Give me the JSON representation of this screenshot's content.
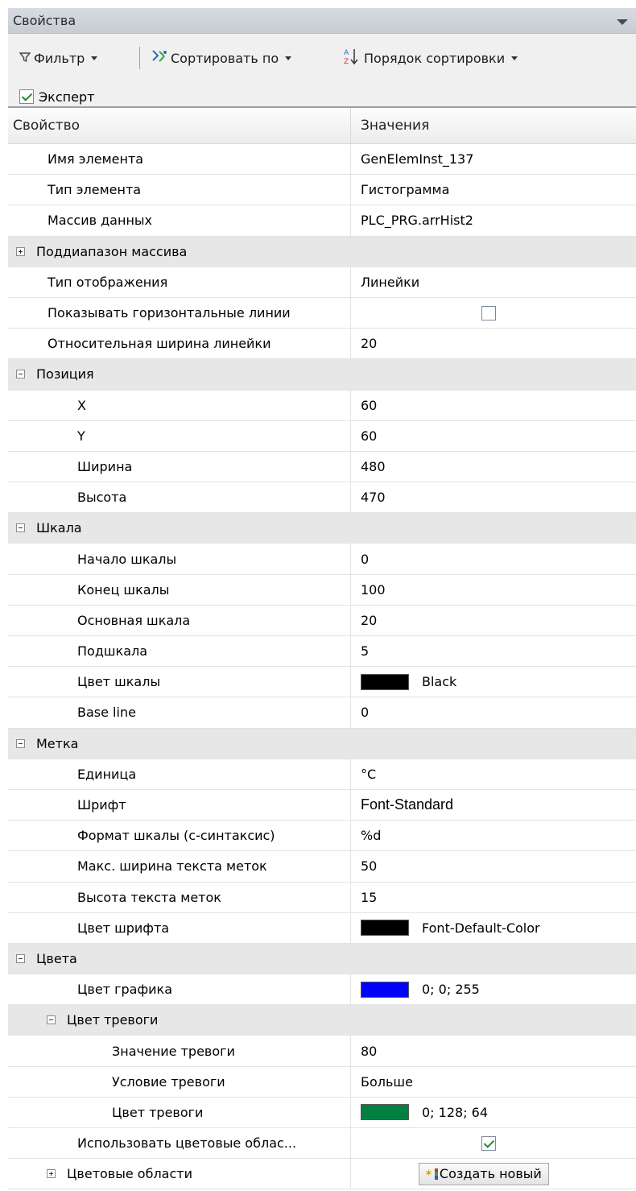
{
  "panel": {
    "title": "Свойства"
  },
  "toolbar": {
    "filter_label": "Фильтр",
    "sort_by_label": "Сортировать по",
    "sort_order_label": "Порядок сортировки",
    "expert_label": "Эксперт",
    "expert_checked": true
  },
  "columns": {
    "property": "Свойство",
    "value": "Значения"
  },
  "rows": {
    "element_name": {
      "label": "Имя элемента",
      "value": "GenElemInst_137"
    },
    "element_type": {
      "label": "Тип элемента",
      "value": "Гистограмма"
    },
    "data_array": {
      "label": "Массив данных",
      "value": "PLC_PRG.arrHist2"
    },
    "subrange_group": {
      "label": "Поддиапазон массива"
    },
    "display_type": {
      "label": "Тип отображения",
      "value": "Линейки"
    },
    "show_horizontal_lines": {
      "label": "Показывать горизонтальные линии",
      "checked": false
    },
    "bar_relative_width": {
      "label": "Относительная ширина линейки",
      "value": "20"
    },
    "position_group": {
      "label": "Позиция"
    },
    "pos_x": {
      "label": "X",
      "value": "60"
    },
    "pos_y": {
      "label": "Y",
      "value": "60"
    },
    "pos_width": {
      "label": "Ширина",
      "value": "480"
    },
    "pos_height": {
      "label": "Высота",
      "value": "470"
    },
    "scale_group": {
      "label": "Шкала"
    },
    "scale_start": {
      "label": "Начало шкалы",
      "value": "0"
    },
    "scale_end": {
      "label": "Конец шкалы",
      "value": "100"
    },
    "scale_main": {
      "label": "Основная шкала",
      "value": "20"
    },
    "scale_sub": {
      "label": "Подшкала",
      "value": "5"
    },
    "scale_color": {
      "label": "Цвет шкалы",
      "value": "Black",
      "swatch": "#000000"
    },
    "base_line": {
      "label": "Base line",
      "value": "0"
    },
    "label_group": {
      "label": "Метка"
    },
    "unit": {
      "label": "Единица",
      "value": "°C"
    },
    "font": {
      "label": "Шрифт",
      "value": "Font-Standard"
    },
    "scale_format": {
      "label": "Формат шкалы (c-синтаксис)",
      "value": "%d"
    },
    "max_label_width": {
      "label": "Макс. ширина текста меток",
      "value": "50"
    },
    "label_text_height": {
      "label": "Высота текста меток",
      "value": "15"
    },
    "font_color": {
      "label": "Цвет шрифта",
      "value": "Font-Default-Color",
      "swatch": "#000000"
    },
    "colors_group": {
      "label": "Цвета"
    },
    "graph_color": {
      "label": "Цвет графика",
      "value": "0; 0; 255",
      "swatch": "#0000ff"
    },
    "alarm_color_group": {
      "label": "Цвет тревоги"
    },
    "alarm_value": {
      "label": "Значение тревоги",
      "value": "80"
    },
    "alarm_condition": {
      "label": "Условие тревоги",
      "value": "Больше"
    },
    "alarm_color": {
      "label": "Цвет тревоги",
      "value": "0; 128; 64",
      "swatch": "#008040"
    },
    "use_color_areas": {
      "label": "Использовать цветовые облас...",
      "checked": true
    },
    "color_areas_group": {
      "label": "Цветовые области",
      "button": "Создать новый"
    }
  }
}
